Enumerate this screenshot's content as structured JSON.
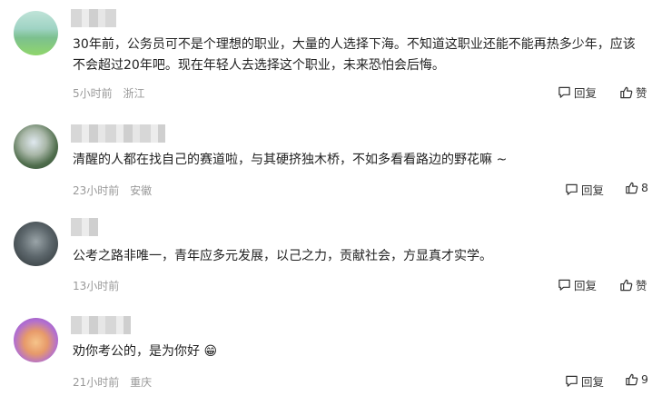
{
  "comments": [
    {
      "text": "30年前，公务员可不是个理想的职业，大量的人选择下海。不知道这职业还能不能再热多少年，应该不会超过20年吧。现在年轻人去选择这个职业，未来恐怕会后悔。",
      "time": "5小时前",
      "location": "浙江",
      "reply_label": "回复",
      "like_label": "赞"
    },
    {
      "text": "清醒的人都在找自己的赛道啦，与其硬挤独木桥，不如多看看路边的野花嘛 ~",
      "time": "23小时前",
      "location": "安徽",
      "reply_label": "回复",
      "like_label": "8"
    },
    {
      "text": "公考之路非唯一，青年应多元发展，以己之力，贡献社会，方显真才实学。",
      "time": "13小时前",
      "location": "",
      "reply_label": "回复",
      "like_label": "赞"
    },
    {
      "text": "劝你考公的，是为你好 😁",
      "time": "21小时前",
      "location": "重庆",
      "reply_label": "回复",
      "like_label": "9"
    }
  ],
  "colors": {
    "meta": "#999999",
    "text": "#222222"
  }
}
